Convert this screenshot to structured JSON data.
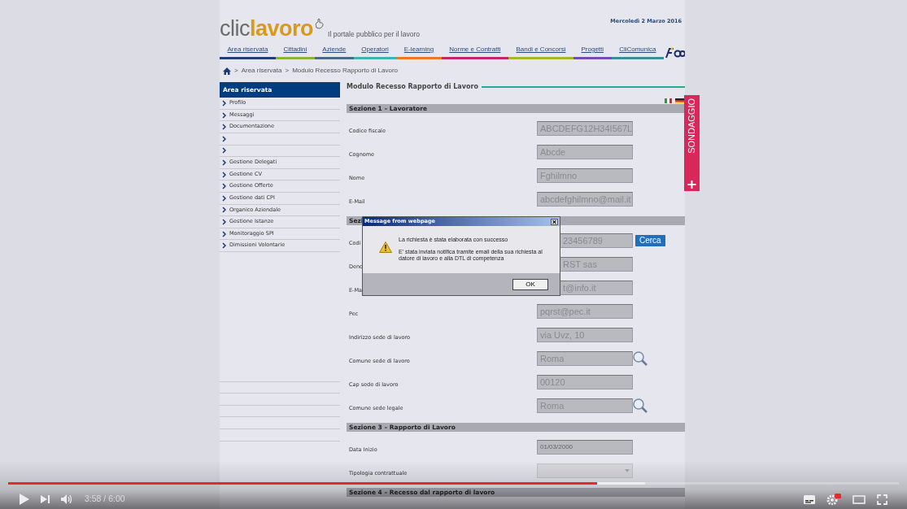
{
  "site": {
    "logo": {
      "light": "clic",
      "bold": "lavoro"
    },
    "tagline": "Il portale pubblico per il lavoro",
    "date": "Mercoledì 2 Marzo 2016",
    "nav": [
      {
        "label": "Area riservata",
        "color": "#1f3f7a"
      },
      {
        "label": "Cittadini",
        "color": "#8cb43c"
      },
      {
        "label": "Aziende",
        "color": "#4a6a8a"
      },
      {
        "label": "Operatori",
        "color": "#3cb4b4"
      },
      {
        "label": "E-learning",
        "color": "#e8782a"
      },
      {
        "label": "Norme e Contratti",
        "color": "#c0286e"
      },
      {
        "label": "Bandi e Concorsi",
        "color": "#a8b42a"
      },
      {
        "label": "Progetti",
        "color": "#7a4ab4"
      },
      {
        "label": "CliComunica",
        "color": "#3c8c9c"
      }
    ],
    "breadcrumb": {
      "separator": ">",
      "link": "Area riservata",
      "separator_2": ">",
      "current": "Modulo Recesso Rapporto di Lavoro"
    },
    "sidebar": {
      "title": "Area riservata",
      "items": [
        {
          "kind": "link",
          "label": "Profilo"
        },
        {
          "kind": "link",
          "label": "Messaggi"
        },
        {
          "kind": "link",
          "label": "Documentazione"
        },
        {
          "kind": "blank"
        },
        {
          "kind": "blank"
        },
        {
          "kind": "link",
          "label": "Gestione Delegati"
        },
        {
          "kind": "link",
          "label": "Gestione CV"
        },
        {
          "kind": "link",
          "label": "Gestione Offerte"
        },
        {
          "kind": "link",
          "label": "Gestione dati CPI"
        },
        {
          "kind": "link",
          "label": "Organico Aziendale"
        },
        {
          "kind": "link",
          "label": "Gestione Istanze"
        },
        {
          "kind": "link",
          "label": "Monitoraggio SPI"
        },
        {
          "kind": "link",
          "label": "Dimissioni Volontarie"
        }
      ]
    },
    "form": {
      "title": "Modulo Recesso Rapporto di Lavoro",
      "sections": [
        {
          "title": "Sezione 1 – Lavoratore",
          "fields": [
            {
              "kind": "text",
              "label": "Codice fiscale",
              "value": "ABCDEFG12H34I567L",
              "disabled": true
            },
            {
              "kind": "text",
              "label": "Cognome",
              "value": "Abcde",
              "disabled": true
            },
            {
              "kind": "text",
              "label": "Nome",
              "value": "Fghilmno",
              "disabled": true
            },
            {
              "kind": "text",
              "label": "E-Mail",
              "value": "abcdefghilmno@mail.it",
              "disabled": true
            }
          ]
        },
        {
          "title": "Sezi",
          "fields": [
            {
              "kind": "button",
              "label": "Codi",
              "value": "23456789",
              "disabled": true,
              "covered": true,
              "button": "Cerca"
            },
            {
              "kind": "text",
              "label": "Deno",
              "value": "RST sas",
              "disabled": true,
              "covered": true
            },
            {
              "kind": "text",
              "label": "E-Ma",
              "value": "t@info.it",
              "disabled": true,
              "covered": true
            },
            {
              "kind": "text",
              "label": "Pec",
              "value": "pqrst@pec.it",
              "disabled": true
            },
            {
              "kind": "text",
              "label": "Indirizzo sede di lavoro",
              "value": "via Uvz, 10",
              "disabled": true
            },
            {
              "kind": "search",
              "label": "Comune sede di lavoro",
              "value": "Roma",
              "disabled": true
            },
            {
              "kind": "text",
              "label": "Cap sede di lavoro",
              "value": "00120",
              "disabled": true
            },
            {
              "kind": "search",
              "label": "Comune sede legale",
              "value": "Roma",
              "disabled": true
            }
          ]
        },
        {
          "title": "Sezione 3 – Rapporto di Lavoro",
          "fields": [
            {
              "kind": "date",
              "label": "Data Inizio",
              "value": "01/03/2000",
              "disabled": true
            },
            {
              "kind": "select",
              "label": "Tipologia contrattuale",
              "disabled": true
            }
          ]
        },
        {
          "title": "Sezione 4 – Recesso dal rapporto di lavoro"
        }
      ]
    },
    "survey_tab": {
      "label": "SONDAGGIO",
      "plus": "+"
    }
  },
  "dialog": {
    "title": "Message from webpage",
    "messages": [
      "La richiesta è stata elaborata con successo",
      "E' stata inviata notifica tramite email della sua richiesta al datore di lavoro e alla DTL di competenza"
    ],
    "ok": "OK"
  },
  "player": {
    "level": 0.661,
    "buffered": {
      "level": 0.715
    },
    "time": "3:58 / 6:00"
  }
}
